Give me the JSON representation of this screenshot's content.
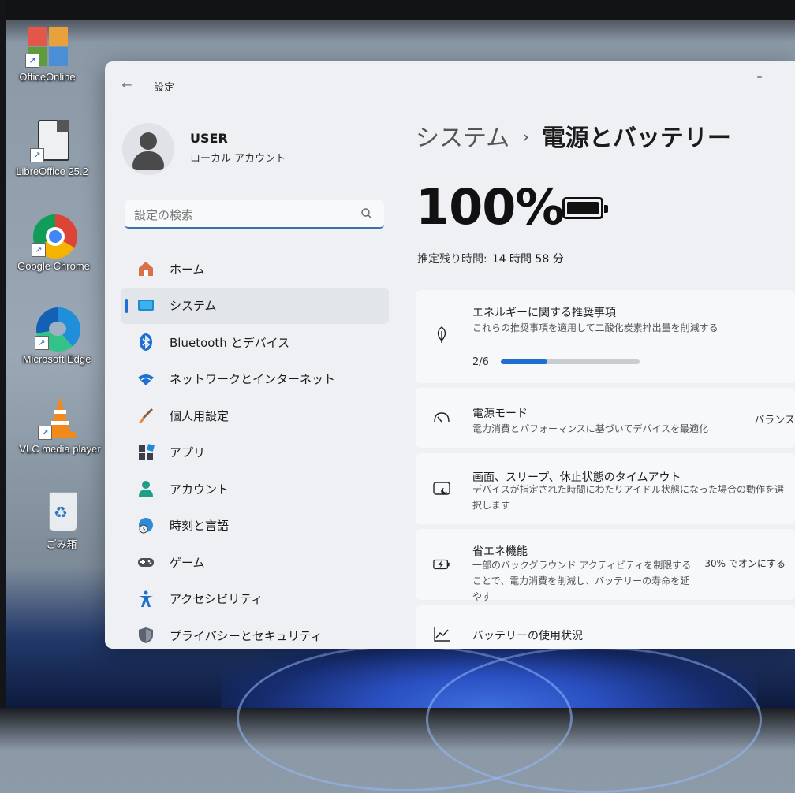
{
  "desktop": {
    "icons": [
      {
        "label": "OfficeOnline",
        "icon": "office-icon"
      },
      {
        "label": "LibreOffice 25.2",
        "icon": "libreoffice-icon"
      },
      {
        "label": "Google Chrome",
        "icon": "chrome-icon"
      },
      {
        "label": "Microsoft Edge",
        "icon": "edge-icon"
      },
      {
        "label": "VLC media player",
        "icon": "vlc-icon"
      },
      {
        "label": "ごみ箱",
        "icon": "recycle-bin-icon"
      }
    ]
  },
  "window": {
    "title": "設定",
    "back_icon": "←",
    "minimize_icon": "–"
  },
  "user": {
    "name": "USER",
    "account_type": "ローカル アカウント"
  },
  "search": {
    "placeholder": "設定の検索"
  },
  "nav": {
    "items": [
      {
        "label": "ホーム",
        "icon": "home-icon",
        "active": false
      },
      {
        "label": "システム",
        "icon": "system-icon",
        "active": true
      },
      {
        "label": "Bluetooth とデバイス",
        "icon": "bluetooth-icon",
        "active": false
      },
      {
        "label": "ネットワークとインターネット",
        "icon": "wifi-icon",
        "active": false
      },
      {
        "label": "個人用設定",
        "icon": "brush-icon",
        "active": false
      },
      {
        "label": "アプリ",
        "icon": "apps-icon",
        "active": false
      },
      {
        "label": "アカウント",
        "icon": "account-icon",
        "active": false
      },
      {
        "label": "時刻と言語",
        "icon": "time-language-icon",
        "active": false
      },
      {
        "label": "ゲーム",
        "icon": "gamepad-icon",
        "active": false
      },
      {
        "label": "アクセシビリティ",
        "icon": "accessibility-icon",
        "active": false
      },
      {
        "label": "プライバシーとセキュリティ",
        "icon": "shield-icon",
        "active": false
      }
    ]
  },
  "content": {
    "breadcrumb_parent": "システム",
    "breadcrumb_sep": "›",
    "breadcrumb_current": "電源とバッテリー",
    "battery_percent": "100%",
    "remaining_label": "推定残り時間:",
    "remaining_value": "14 時間 58 分",
    "cards": {
      "energy": {
        "title": "エネルギーに関する推奨事項",
        "desc": "これらの推奨事項を適用して二酸化炭素排出量を削減する",
        "progress_text": "2/6",
        "progress_fraction": 0.333
      },
      "power_mode": {
        "title": "電源モード",
        "desc": "電力消費とパフォーマンスに基づいてデバイスを最適化",
        "value": "バランス"
      },
      "screen_sleep": {
        "title": "画面、スリープ、休止状態のタイムアウト",
        "desc": "デバイスが指定された時間にわたりアイドル状態になった場合の動作を選択します"
      },
      "battery_saver": {
        "title": "省エネ機能",
        "desc": "一部のバックグラウンド アクティビティを制限することで、電力消費を削減し、バッテリーの寿命を延やす",
        "value": "30% でオンにする"
      },
      "battery_usage": {
        "title": "バッテリーの使用状況"
      }
    }
  }
}
